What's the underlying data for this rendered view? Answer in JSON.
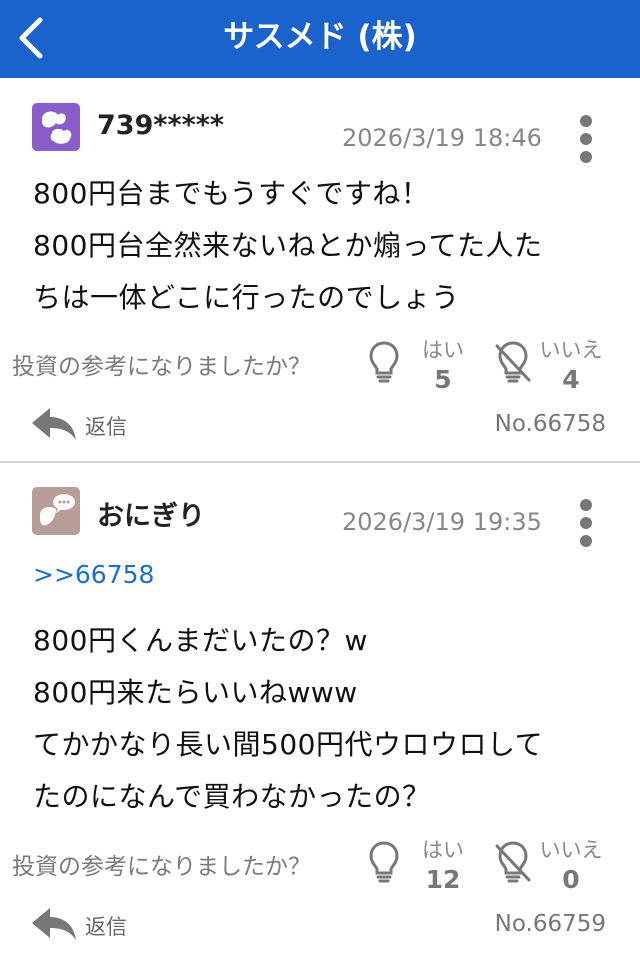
{
  "header": {
    "title": "サスメド (株)",
    "back_icon": "chevron-left-icon"
  },
  "colors": {
    "header_bg": "#1a62cc",
    "link": "#1a6fd1",
    "avatar_1": "#8a5cc9",
    "avatar_2": "#b79c97"
  },
  "posts": [
    {
      "username": "739*****",
      "timestamp": "2026/3/19 18:46",
      "reply_to": "",
      "lines": [
        "800円台までもうすぐですね！",
        "800円台全然来ないねとか煽ってた人た",
        "ちは一体どこに行ったのでしょう"
      ],
      "question": "投資の参考になりましたか？",
      "yes_label": "はい",
      "yes_count": "5",
      "no_label": "いいえ",
      "no_count": "4",
      "reply_label": "返信",
      "number": "No.66758"
    },
    {
      "username": "おにぎり",
      "timestamp": "2026/3/19 19:35",
      "reply_to": ">>66758",
      "lines": [
        "800円くんまだいたの？w",
        "800円来たらいいねwww",
        "てかかなり長い間500円代ウロウロして",
        "たのになんで買わなかったの？"
      ],
      "question": "投資の参考になりましたか？",
      "yes_label": "はい",
      "yes_count": "12",
      "no_label": "いいえ",
      "no_count": "0",
      "reply_label": "返信",
      "number": "No.66759"
    }
  ]
}
